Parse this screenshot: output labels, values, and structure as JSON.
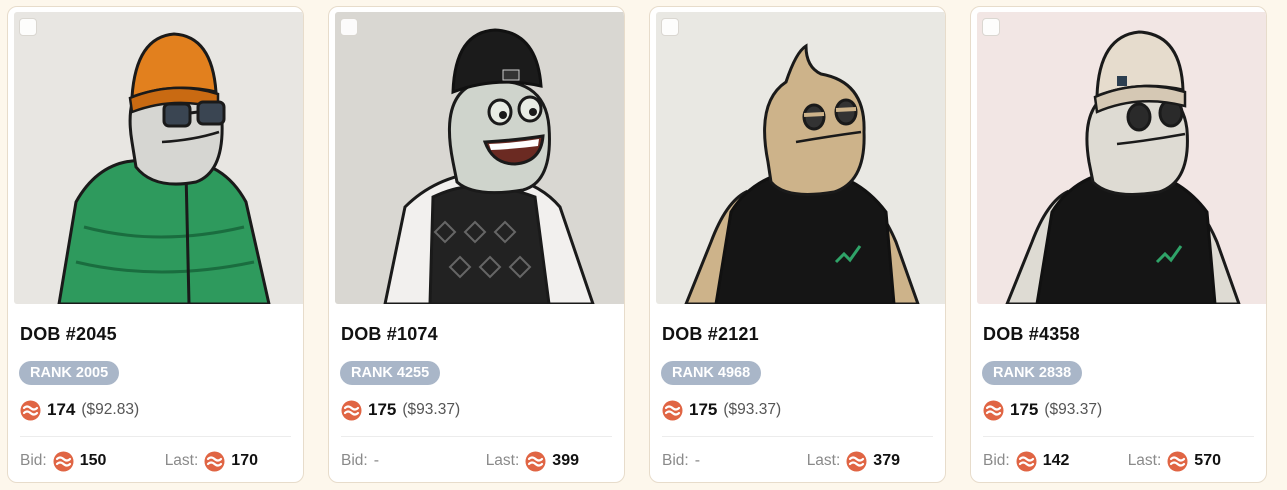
{
  "cards": [
    {
      "title": "DOB #2045",
      "rank": "RANK 2005",
      "price": "174",
      "price_usd": "($92.83)",
      "bid_label": "Bid:",
      "bid_value": "150",
      "last_label": "Last:",
      "last_value": "170",
      "art": {
        "bg": "#e8e6e2",
        "body": "#d6d6d2",
        "hat": "#e2801e",
        "outfit": "#2e9a5d",
        "accessory": "sunglasses"
      }
    },
    {
      "title": "DOB #1074",
      "rank": "RANK 4255",
      "price": "175",
      "price_usd": "($93.37)",
      "bid_label": "Bid:",
      "bid_value": "-",
      "last_label": "Last:",
      "last_value": "399",
      "art": {
        "bg": "#d9d7d2",
        "body": "#cfd4cc",
        "hat": "#1b1b1b",
        "outfit": "#1f1f1f",
        "accessory": "open-mouth"
      }
    },
    {
      "title": "DOB #2121",
      "rank": "RANK 4968",
      "price": "175",
      "price_usd": "($93.37)",
      "bid_label": "Bid:",
      "bid_value": "-",
      "last_label": "Last:",
      "last_value": "379",
      "art": {
        "bg": "#e9e8e3",
        "body": "#cdb38a",
        "hat": "none",
        "outfit": "#151515",
        "accessory": "sleepy-eyes"
      }
    },
    {
      "title": "DOB #4358",
      "rank": "RANK 2838",
      "price": "175",
      "price_usd": "($93.37)",
      "bid_label": "Bid:",
      "bid_value": "142",
      "last_label": "Last:",
      "last_value": "570",
      "art": {
        "bg": "#f2e6e4",
        "body": "#dedbd3",
        "hat": "#e6dccd",
        "outfit": "#151515",
        "accessory": "round-eyes"
      }
    }
  ],
  "colors": {
    "coin": "#e06544",
    "rank_badge": "#a9b6c8",
    "page_bg": "#fdf7ec"
  },
  "icons": {
    "coin": "coin-icon",
    "checkbox": "select-checkbox"
  }
}
